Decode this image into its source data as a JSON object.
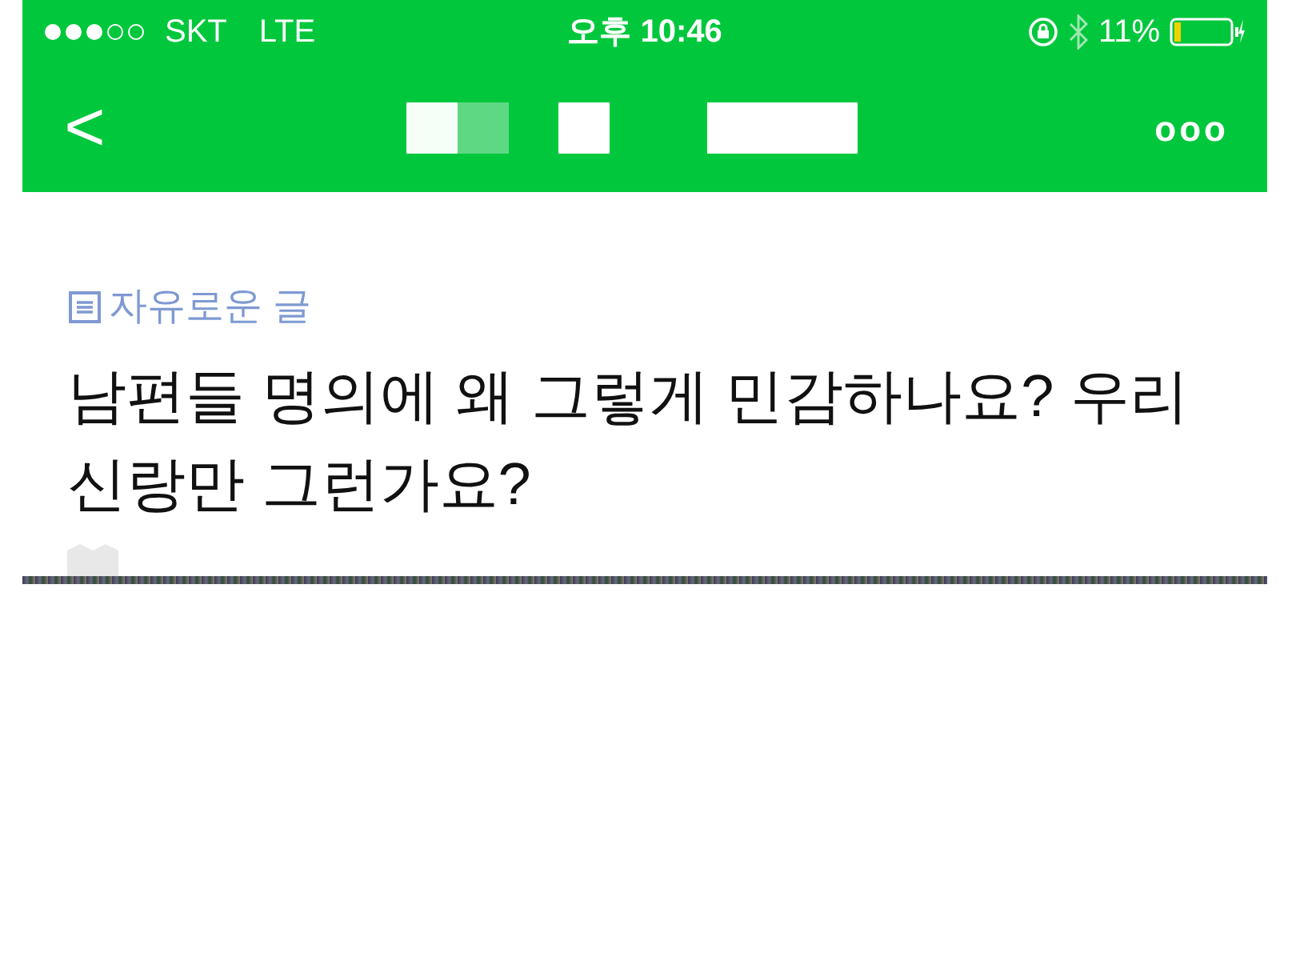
{
  "status_bar": {
    "carrier": "SKT",
    "network": "LTE",
    "time": "오후 10:46",
    "battery": "11%"
  },
  "nav_bar": {
    "back": "<",
    "more": "ooo"
  },
  "post": {
    "category": "자유로운 글",
    "title": "남편들 명의에 왜 그렇게 민감하나요? 우리 신랑만 그런가요?"
  }
}
